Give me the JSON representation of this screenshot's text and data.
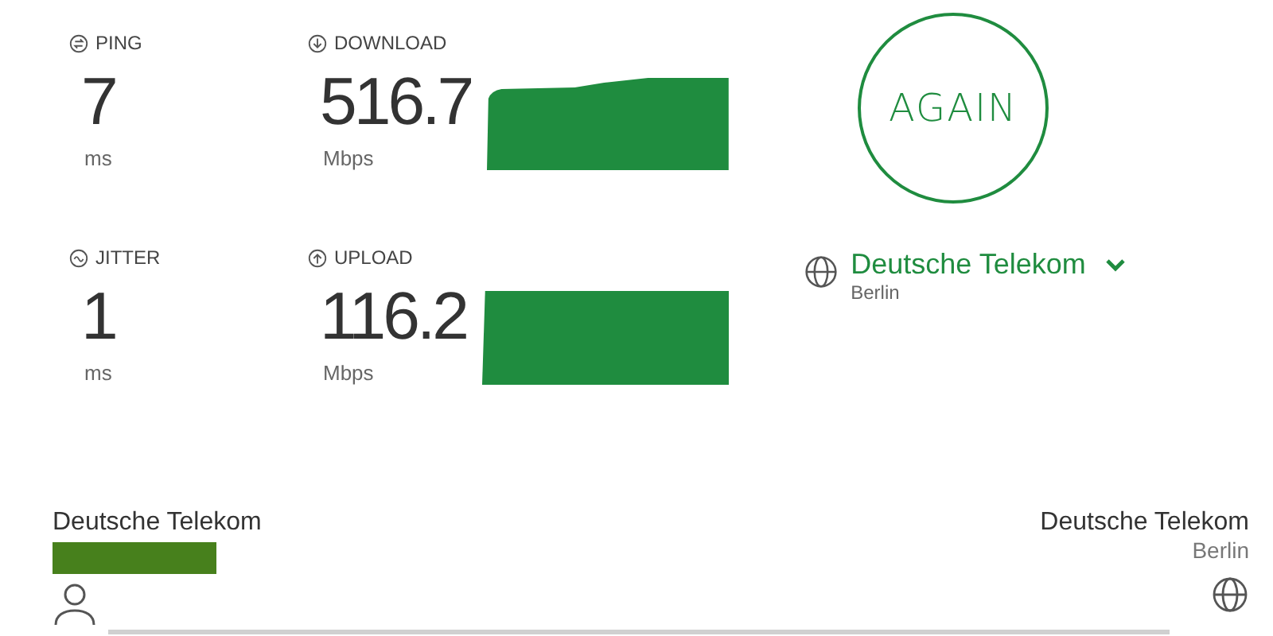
{
  "metrics": [
    {
      "kind": "ping",
      "label": "PING",
      "value": "7",
      "unit": "ms"
    },
    {
      "kind": "download",
      "label": "DOWNLOAD",
      "value": "516.7",
      "unit": "Mbps",
      "has_graph": true
    },
    {
      "kind": "jitter",
      "label": "JITTER",
      "value": "1",
      "unit": "ms"
    },
    {
      "kind": "upload",
      "label": "UPLOAD",
      "value": "116.2",
      "unit": "Mbps",
      "has_graph": true
    }
  ],
  "again_button": "AGAIN",
  "server": {
    "provider": "Deutsche Telekom",
    "location": "Berlin"
  },
  "connection": {
    "client_provider": "Deutsche Telekom",
    "server_provider": "Deutsche Telekom",
    "server_location": "Berlin"
  }
}
